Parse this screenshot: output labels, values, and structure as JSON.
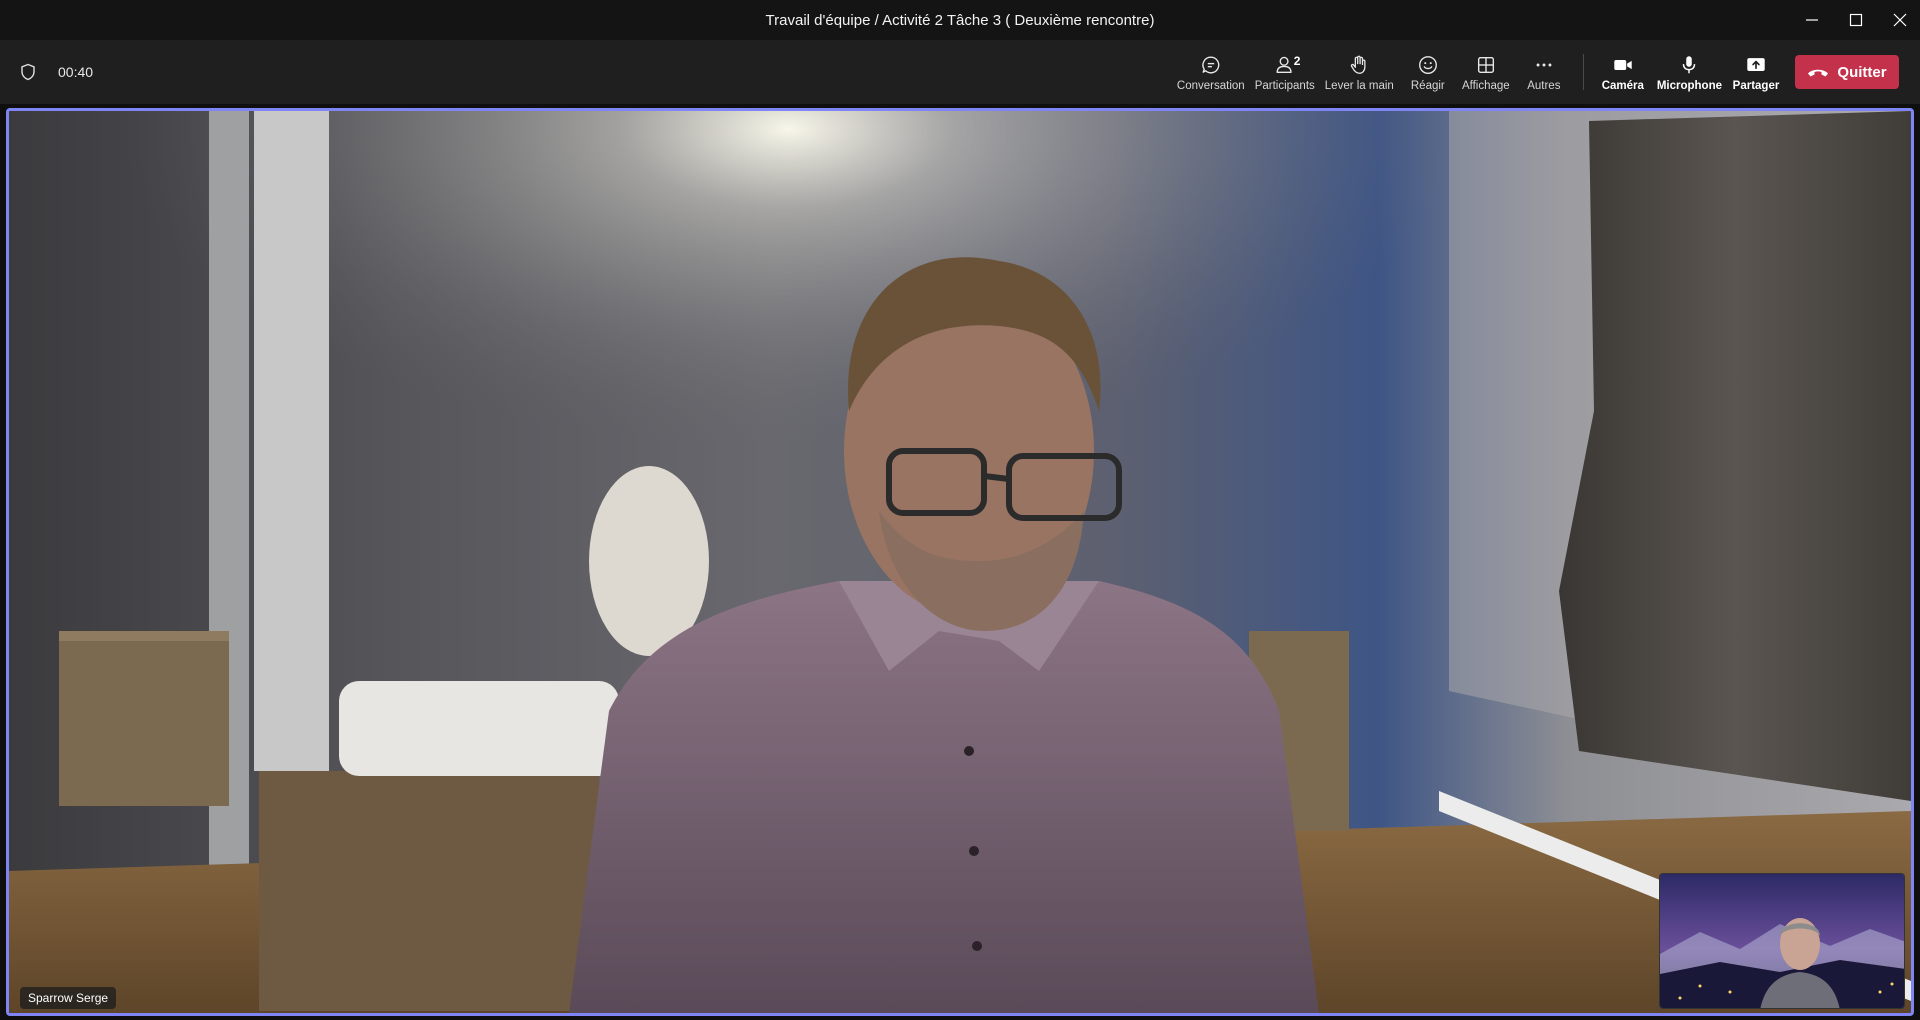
{
  "window": {
    "title": "Travail d'équipe / Activité 2 Tâche 3 ( Deuxième rencontre)"
  },
  "toolbar": {
    "timer": "00:40",
    "participants_count": "2",
    "items": {
      "conversation": "Conversation",
      "participants": "Participants",
      "raise_hand": "Lever la main",
      "react": "Réagir",
      "view": "Affichage",
      "more": "Autres",
      "camera": "Caméra",
      "microphone": "Microphone",
      "share": "Partager"
    },
    "leave_label": "Quitter"
  },
  "stage": {
    "speaker_name": "Sparrow Serge"
  },
  "colors": {
    "accent_border": "#7f85f5",
    "leave_button": "#c4314b",
    "toolbar_bg": "#1f1f1f",
    "titlebar_bg": "#141414"
  }
}
